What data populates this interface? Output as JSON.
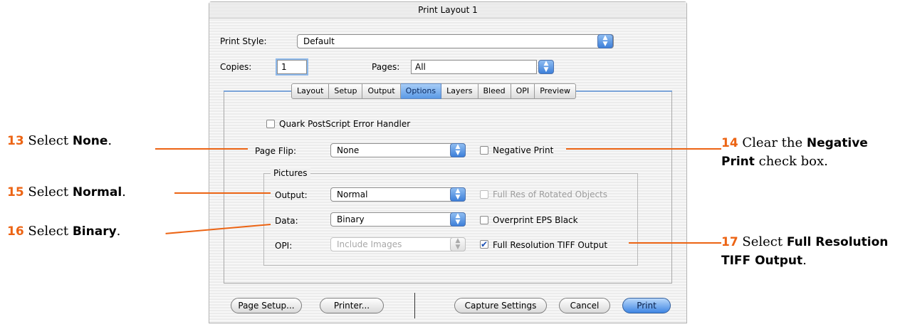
{
  "window": {
    "title": "Print Layout 1"
  },
  "print_style": {
    "label": "Print Style:",
    "value": "Default"
  },
  "copies": {
    "label": "Copies:",
    "value": "1"
  },
  "pages": {
    "label": "Pages:",
    "value": "All"
  },
  "tabs": [
    {
      "label": "Layout"
    },
    {
      "label": "Setup"
    },
    {
      "label": "Output"
    },
    {
      "label": "Options",
      "active": true
    },
    {
      "label": "Layers"
    },
    {
      "label": "Bleed"
    },
    {
      "label": "OPI"
    },
    {
      "label": "Preview"
    }
  ],
  "options": {
    "error_handler": {
      "label": "Quark PostScript Error Handler",
      "checked": false
    },
    "page_flip": {
      "label": "Page Flip:",
      "value": "None"
    },
    "negative_print": {
      "label": "Negative Print",
      "checked": false
    },
    "pictures_group": {
      "label": "Pictures"
    },
    "output": {
      "label": "Output:",
      "value": "Normal"
    },
    "full_res_rotated": {
      "label": "Full Res of Rotated Objects",
      "checked": false,
      "enabled": false
    },
    "data": {
      "label": "Data:",
      "value": "Binary"
    },
    "overprint_eps": {
      "label": "Overprint EPS Black",
      "checked": false
    },
    "opi": {
      "label": "OPI:",
      "value": "Include Images",
      "enabled": false
    },
    "full_res_tiff": {
      "label": "Full Resolution TIFF Output",
      "checked": true,
      "check_glyph": "✔"
    }
  },
  "buttons": {
    "page_setup": "Page Setup...",
    "printer": "Printer...",
    "capture_settings": "Capture Settings",
    "cancel": "Cancel",
    "print": "Print"
  },
  "annotations": {
    "a13": {
      "number": "13",
      "prefix": "Select ",
      "bold": "None",
      "suffix": "."
    },
    "a14": {
      "number": "14",
      "prefix": "Clear the ",
      "bold1": "Negative",
      "bold2": "Print",
      "suffix": " check box."
    },
    "a15": {
      "number": "15",
      "prefix": "Select ",
      "bold": "Normal",
      "suffix": "."
    },
    "a16": {
      "number": "16",
      "prefix": "Select ",
      "bold": "Binary",
      "suffix": "."
    },
    "a17": {
      "number": "17",
      "prefix": "Select ",
      "bold1": "Full Resolution",
      "bold2": "TIFF Output",
      "suffix": "."
    }
  },
  "colors": {
    "accent": "#ec6414",
    "tab_active": "#5b9ae6",
    "default_button": "#3f86e3"
  },
  "icons": {
    "popup_arrows": "▲▼"
  }
}
